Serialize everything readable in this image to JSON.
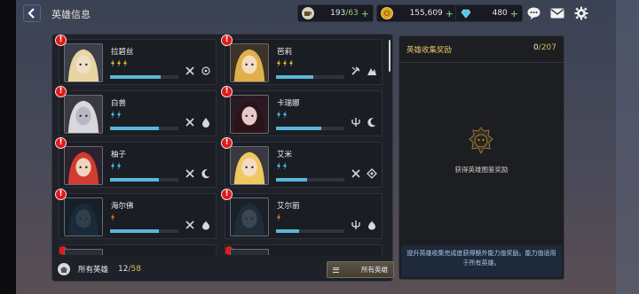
{
  "header": {
    "title": "英雄信息"
  },
  "resources": [
    {
      "name": "stamina",
      "icon": "coffee-cup-icon",
      "current": "193",
      "max": "/63"
    },
    {
      "name": "gold",
      "icon": "gold-coin-icon",
      "current": "155,609",
      "max": ""
    },
    {
      "name": "gems",
      "icon": "gem-icon",
      "current": "480",
      "max": ""
    }
  ],
  "top_buttons": [
    "chat-icon",
    "mail-icon",
    "settings-icon"
  ],
  "heroes": [
    {
      "name": "拉碧丝",
      "stars": 3,
      "star_color": "gold",
      "progress": 0.74,
      "roles": [
        "swords-icon",
        "target-icon"
      ]
    },
    {
      "name": "芭莉",
      "stars": 3,
      "star_color": "gold",
      "progress": 0.55,
      "roles": [
        "hammer-icon",
        "mountain-icon"
      ]
    },
    {
      "name": "白兽",
      "stars": 2,
      "star_color": "blue",
      "progress": 0.72,
      "roles": [
        "swords-icon",
        "drop-icon"
      ]
    },
    {
      "name": "卡瑞娜",
      "stars": 2,
      "star_color": "blue",
      "progress": 0.66,
      "roles": [
        "trident-icon",
        "moon-icon"
      ]
    },
    {
      "name": "柚子",
      "stars": 2,
      "star_color": "blue",
      "progress": 0.72,
      "roles": [
        "swords-icon",
        "moon-icon"
      ]
    },
    {
      "name": "艾米",
      "stars": 2,
      "star_color": "blue",
      "progress": 0.46,
      "roles": [
        "swords-icon",
        "diamond-icon"
      ]
    },
    {
      "name": "海尔佛",
      "stars": 1,
      "star_color": "orange",
      "progress": 0.72,
      "roles": [
        "swords-icon",
        "fire-icon"
      ]
    },
    {
      "name": "艾尔丽",
      "stars": 1,
      "star_color": "orange",
      "progress": 0.34,
      "roles": [
        "trident-icon",
        "fire-icon"
      ]
    }
  ],
  "footer": {
    "label": "所有英雄",
    "count": "12",
    "max": "/58",
    "filter_label": "所有英雄"
  },
  "reward_panel": {
    "title": "英雄收集奖励",
    "count": "0",
    "max": "/207",
    "caption": "获得英雄图鉴奖励",
    "description": "提升英雄收集完成度获得额外能力值奖励。能力值适用于所有英雄。"
  },
  "colors": {
    "accent_gold": "#e0b85c",
    "progress_blue": "#58b7d8",
    "alert_red": "#e01a1a"
  }
}
